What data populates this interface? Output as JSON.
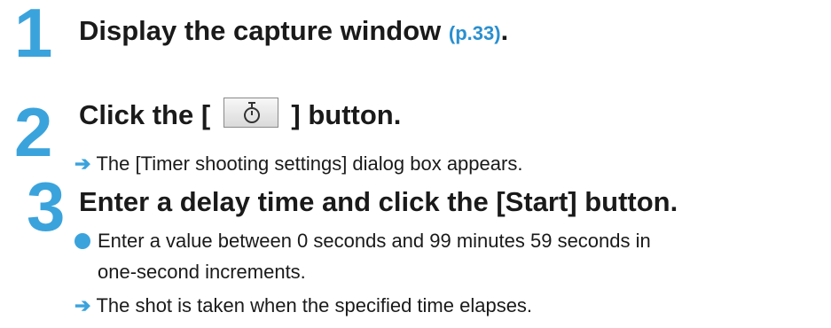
{
  "steps": [
    {
      "number": "1",
      "title": "Display the capture window",
      "page_ref": "(p.33)",
      "title_suffix": "."
    },
    {
      "number": "2",
      "title_before": "Click the [",
      "button_icon": "timer-icon",
      "title_after": "] button.",
      "result": "The [Timer shooting settings] dialog box appears."
    },
    {
      "number": "3",
      "title": "Enter a delay time and click the [Start] button.",
      "bullet_line_1": "Enter a value between 0 seconds and 99 minutes 59 seconds in",
      "bullet_line_2": "one-second increments.",
      "result": "The shot is taken when the specified time elapses."
    }
  ],
  "symbols": {
    "arrow": "➔"
  },
  "colors": {
    "accent": "#3ba3dc",
    "link": "#2a8fd0",
    "text": "#1a1a1a"
  }
}
